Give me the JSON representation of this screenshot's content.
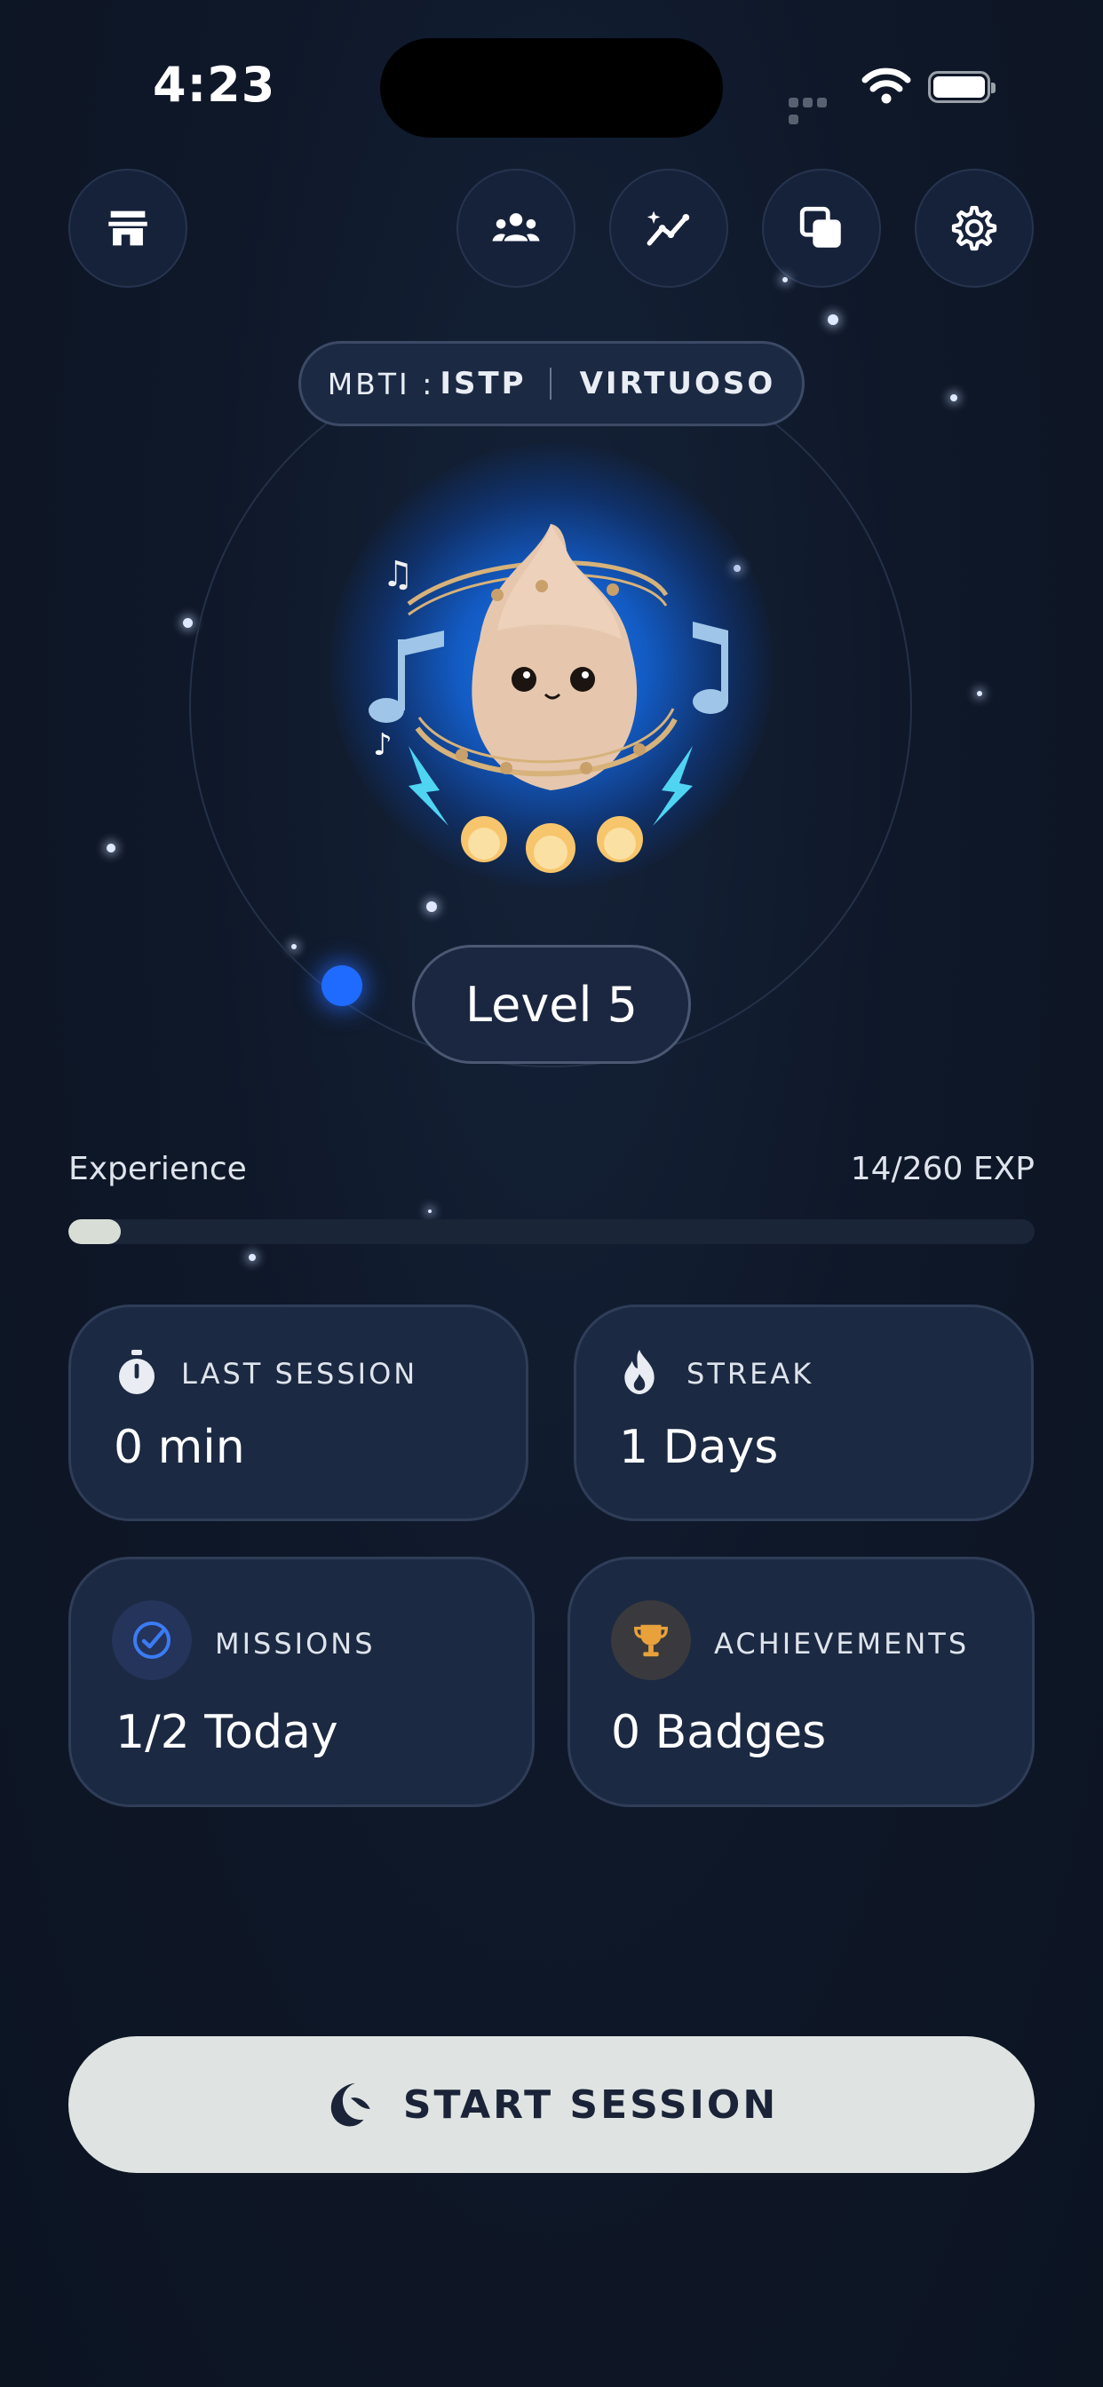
{
  "status_bar": {
    "time": "4:23"
  },
  "top_bar": {
    "icons": [
      "store-icon",
      "community-icon",
      "insights-icon",
      "collection-icon",
      "gear-icon"
    ]
  },
  "profile": {
    "mbti_key": "MBTI :",
    "mbti_value": "ISTP",
    "archetype": "VIRTUOSO",
    "level_label": "Level 5"
  },
  "experience": {
    "label": "Experience",
    "value_text": "14/260 EXP",
    "current": 14,
    "max": 260
  },
  "stats": {
    "last_session": {
      "title": "LAST SESSION",
      "value": "0 min",
      "icon": "stopwatch-icon"
    },
    "streak": {
      "title": "STREAK",
      "value": "1 Days",
      "icon": "flame-icon"
    },
    "missions": {
      "title": "MISSIONS",
      "value": "1/2 Today",
      "icon": "check-circle-icon",
      "accent": "#3b7cf5"
    },
    "achievements": {
      "title": "ACHIEVEMENTS",
      "value": "0 Badges",
      "icon": "trophy-icon",
      "accent": "#e9a23b"
    }
  },
  "cta": {
    "label": "START SESSION",
    "icon": "moon-icon"
  },
  "colors": {
    "background": "#0e1726",
    "card": "#1b2942",
    "orbit_dot": "#1f6bff",
    "button": "#dfe4e2"
  }
}
